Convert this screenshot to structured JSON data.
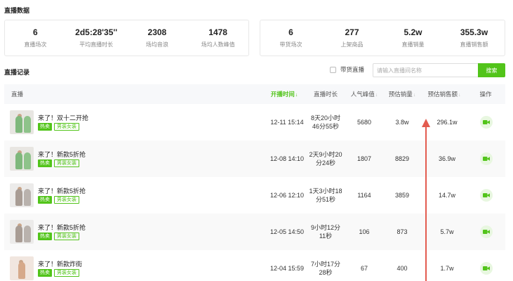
{
  "section_live_data": "直播数据",
  "stats_left": [
    {
      "value": "6",
      "label": "直播场次"
    },
    {
      "value": "2d5:28'35''",
      "label": "平均直播时长"
    },
    {
      "value": "2308",
      "label": "场均音浪"
    },
    {
      "value": "1478",
      "label": "场均人数峰值"
    }
  ],
  "stats_right": [
    {
      "value": "6",
      "label": "带货场次"
    },
    {
      "value": "277",
      "label": "上架商品"
    },
    {
      "value": "5.2w",
      "label": "直播销量"
    },
    {
      "value": "355.3w",
      "label": "直播销售额"
    }
  ],
  "section_live_records": "直播记录",
  "filter_label": "带货直播",
  "search": {
    "placeholder": "请输入直播间名称",
    "button": "搜索"
  },
  "columns": [
    {
      "label": "直播",
      "sort": ""
    },
    {
      "label": "开播时间",
      "sort": "↓"
    },
    {
      "label": "直播时长",
      "sort": ""
    },
    {
      "label": "人气峰值",
      "sort": "↓"
    },
    {
      "label": "预估销量",
      "sort": "↓"
    },
    {
      "label": "预估销售额",
      "sort": "↓"
    },
    {
      "label": "操作",
      "sort": ""
    }
  ],
  "rows": [
    {
      "title": "来了！双十二开抢",
      "tag_hot": "热卖",
      "tag_cat": "男装女装",
      "start": "12-11 15:14",
      "duration_1": "8天20小时",
      "duration_2": "46分55秒",
      "peak": "5680",
      "sales": "3.8w",
      "revenue": "296.1w"
    },
    {
      "title": "来了！新款5折抢",
      "tag_hot": "热卖",
      "tag_cat": "男装女装",
      "start": "12-08 14:10",
      "duration_1": "2天9小时20",
      "duration_2": "分24秒",
      "peak": "1807",
      "sales": "8829",
      "revenue": "36.9w"
    },
    {
      "title": "来了！新款5折抢",
      "tag_hot": "热卖",
      "tag_cat": "男装女装",
      "start": "12-06 12:10",
      "duration_1": "1天3小时18",
      "duration_2": "分51秒",
      "peak": "1164",
      "sales": "3859",
      "revenue": "14.7w"
    },
    {
      "title": "来了！新款5折抢",
      "tag_hot": "热卖",
      "tag_cat": "男装女装",
      "start": "12-05 14:50",
      "duration_1": "9小时12分",
      "duration_2": "11秒",
      "peak": "106",
      "sales": "873",
      "revenue": "5.7w"
    },
    {
      "title": "来了！新款炸街",
      "tag_hot": "热卖",
      "tag_cat": "男装女装",
      "start": "12-04 15:59",
      "duration_1": "7小时17分",
      "duration_2": "28秒",
      "peak": "67",
      "sales": "400",
      "revenue": "1.7w"
    }
  ],
  "icons": {
    "action": "video-camera-icon"
  },
  "colors": {
    "accent": "#52c41a",
    "annotation": "#e35b4f"
  }
}
